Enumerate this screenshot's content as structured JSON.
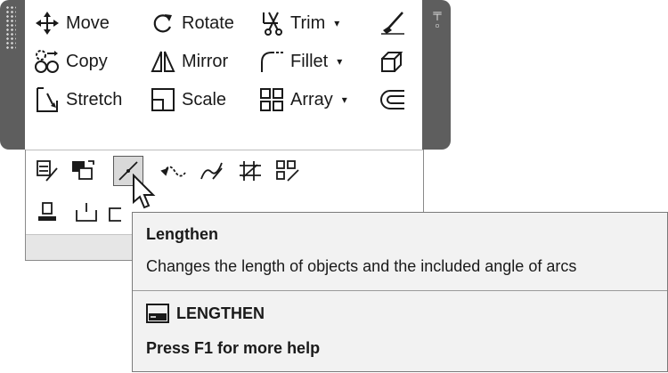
{
  "modify_panel": {
    "tools": [
      {
        "label": "Move",
        "icon": "move-icon"
      },
      {
        "label": "Rotate",
        "icon": "rotate-icon"
      },
      {
        "label": "Trim",
        "icon": "trim-icon",
        "dropdown": true
      },
      {
        "label": "Copy",
        "icon": "copy-icon"
      },
      {
        "label": "Mirror",
        "icon": "mirror-icon"
      },
      {
        "label": "Fillet",
        "icon": "fillet-icon",
        "dropdown": true
      },
      {
        "label": "Stretch",
        "icon": "stretch-icon"
      },
      {
        "label": "Scale",
        "icon": "scale-icon"
      },
      {
        "label": "Array",
        "icon": "array-icon",
        "dropdown": true
      }
    ],
    "dropdown_arrow": "▾",
    "side_icons": [
      "erase-icon",
      "explode-icon",
      "offset-icon"
    ]
  },
  "slideout": {
    "active_tool": "lengthen-icon"
  },
  "tooltip": {
    "title": "Lengthen",
    "description": "Changes the length of objects and the included angle of arcs",
    "command": "LENGTHEN",
    "help": "Press F1 for more help"
  }
}
